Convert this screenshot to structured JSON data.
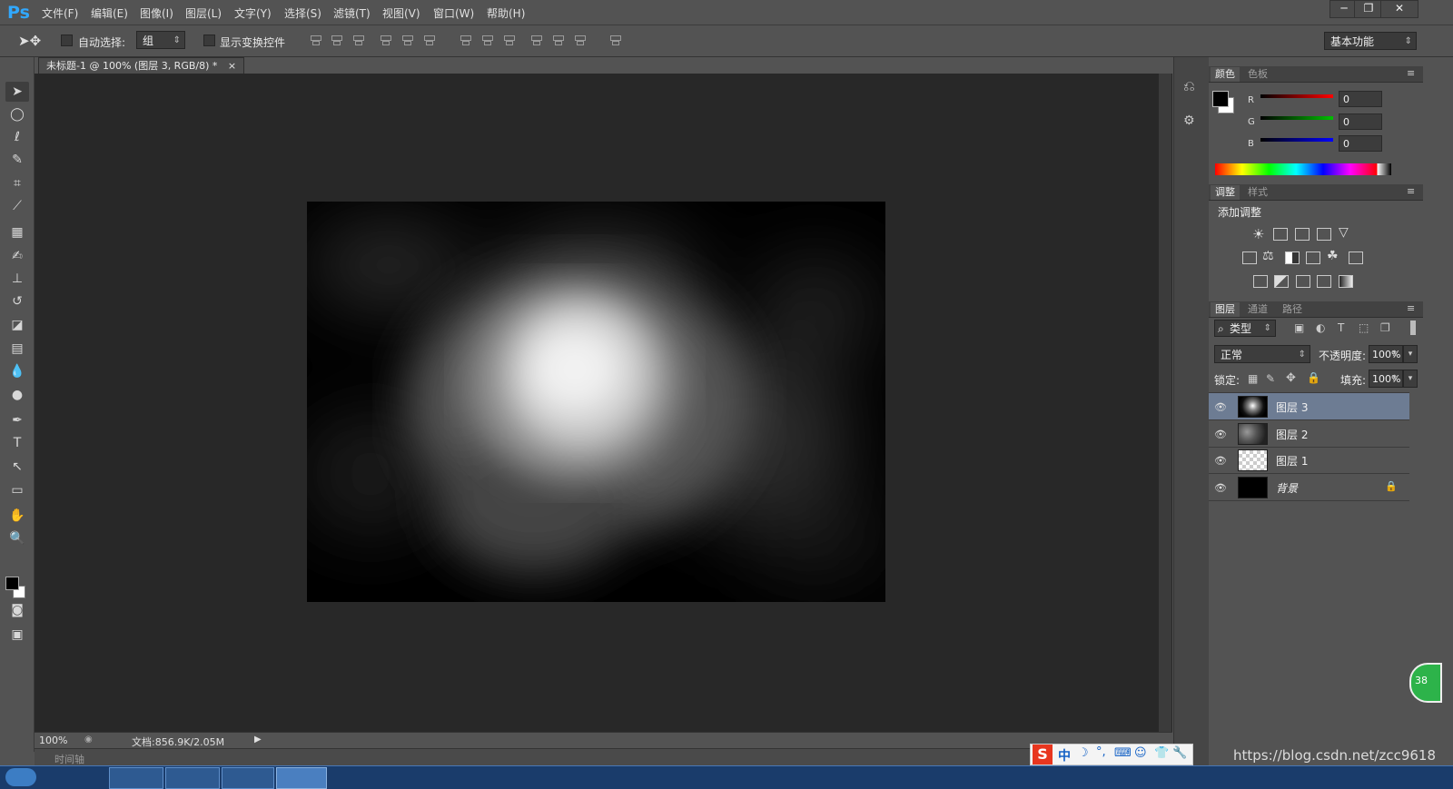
{
  "app": {
    "logo": "Ps"
  },
  "menu": [
    "文件(F)",
    "编辑(E)",
    "图像(I)",
    "图层(L)",
    "文字(Y)",
    "选择(S)",
    "滤镜(T)",
    "视图(V)",
    "窗口(W)",
    "帮助(H)"
  ],
  "window_controls": {
    "minimize": "─",
    "restore": "❐",
    "close": "✕"
  },
  "options_bar": {
    "auto_select_label": "自动选择:",
    "auto_select_value": "组",
    "show_transform_label": "显示变换控件",
    "workspace": "基本功能"
  },
  "document": {
    "tab_title": "未标题-1 @ 100% (图层 3, RGB/8) *",
    "tab_close": "×",
    "zoom": "100%",
    "doc_info": "文档:856.9K/2.05M",
    "timeline_label": "时间轴"
  },
  "tools": [
    "move-icon",
    "marquee-icon",
    "lasso-icon",
    "quick-select-icon",
    "crop-icon",
    "eyedropper-icon",
    "healing-brush-icon",
    "brush-icon",
    "clone-stamp-icon",
    "history-brush-icon",
    "eraser-icon",
    "gradient-icon",
    "blur-icon",
    "dodge-icon",
    "pen-icon",
    "type-icon",
    "path-select-icon",
    "rectangle-icon",
    "hand-icon",
    "zoom-icon"
  ],
  "color_panel": {
    "tabs": [
      "颜色",
      "色板"
    ],
    "channels": [
      {
        "label": "R",
        "value": "0",
        "color": "#ff0000"
      },
      {
        "label": "G",
        "value": "0",
        "color": "#00c000"
      },
      {
        "label": "B",
        "value": "0",
        "color": "#0000ff"
      }
    ]
  },
  "adjustments_panel": {
    "tabs": [
      "调整",
      "样式"
    ],
    "title": "添加调整"
  },
  "layers_panel": {
    "tabs": [
      "图层",
      "通道",
      "路径"
    ],
    "filter_kind": "类型",
    "blend_mode": "正常",
    "opacity_label": "不透明度:",
    "opacity_value": "100%",
    "lock_label": "锁定:",
    "fill_label": "填充:",
    "fill_value": "100%",
    "layers": [
      {
        "name": "图层 3",
        "selected": true
      },
      {
        "name": "图层 2",
        "selected": false
      },
      {
        "name": "图层 1",
        "selected": false
      },
      {
        "name": "背景",
        "selected": false
      }
    ]
  },
  "ime": {
    "brand": "S",
    "mode": "中"
  },
  "watermark": "https://blog.csdn.net/zcc9618",
  "badge": "38"
}
